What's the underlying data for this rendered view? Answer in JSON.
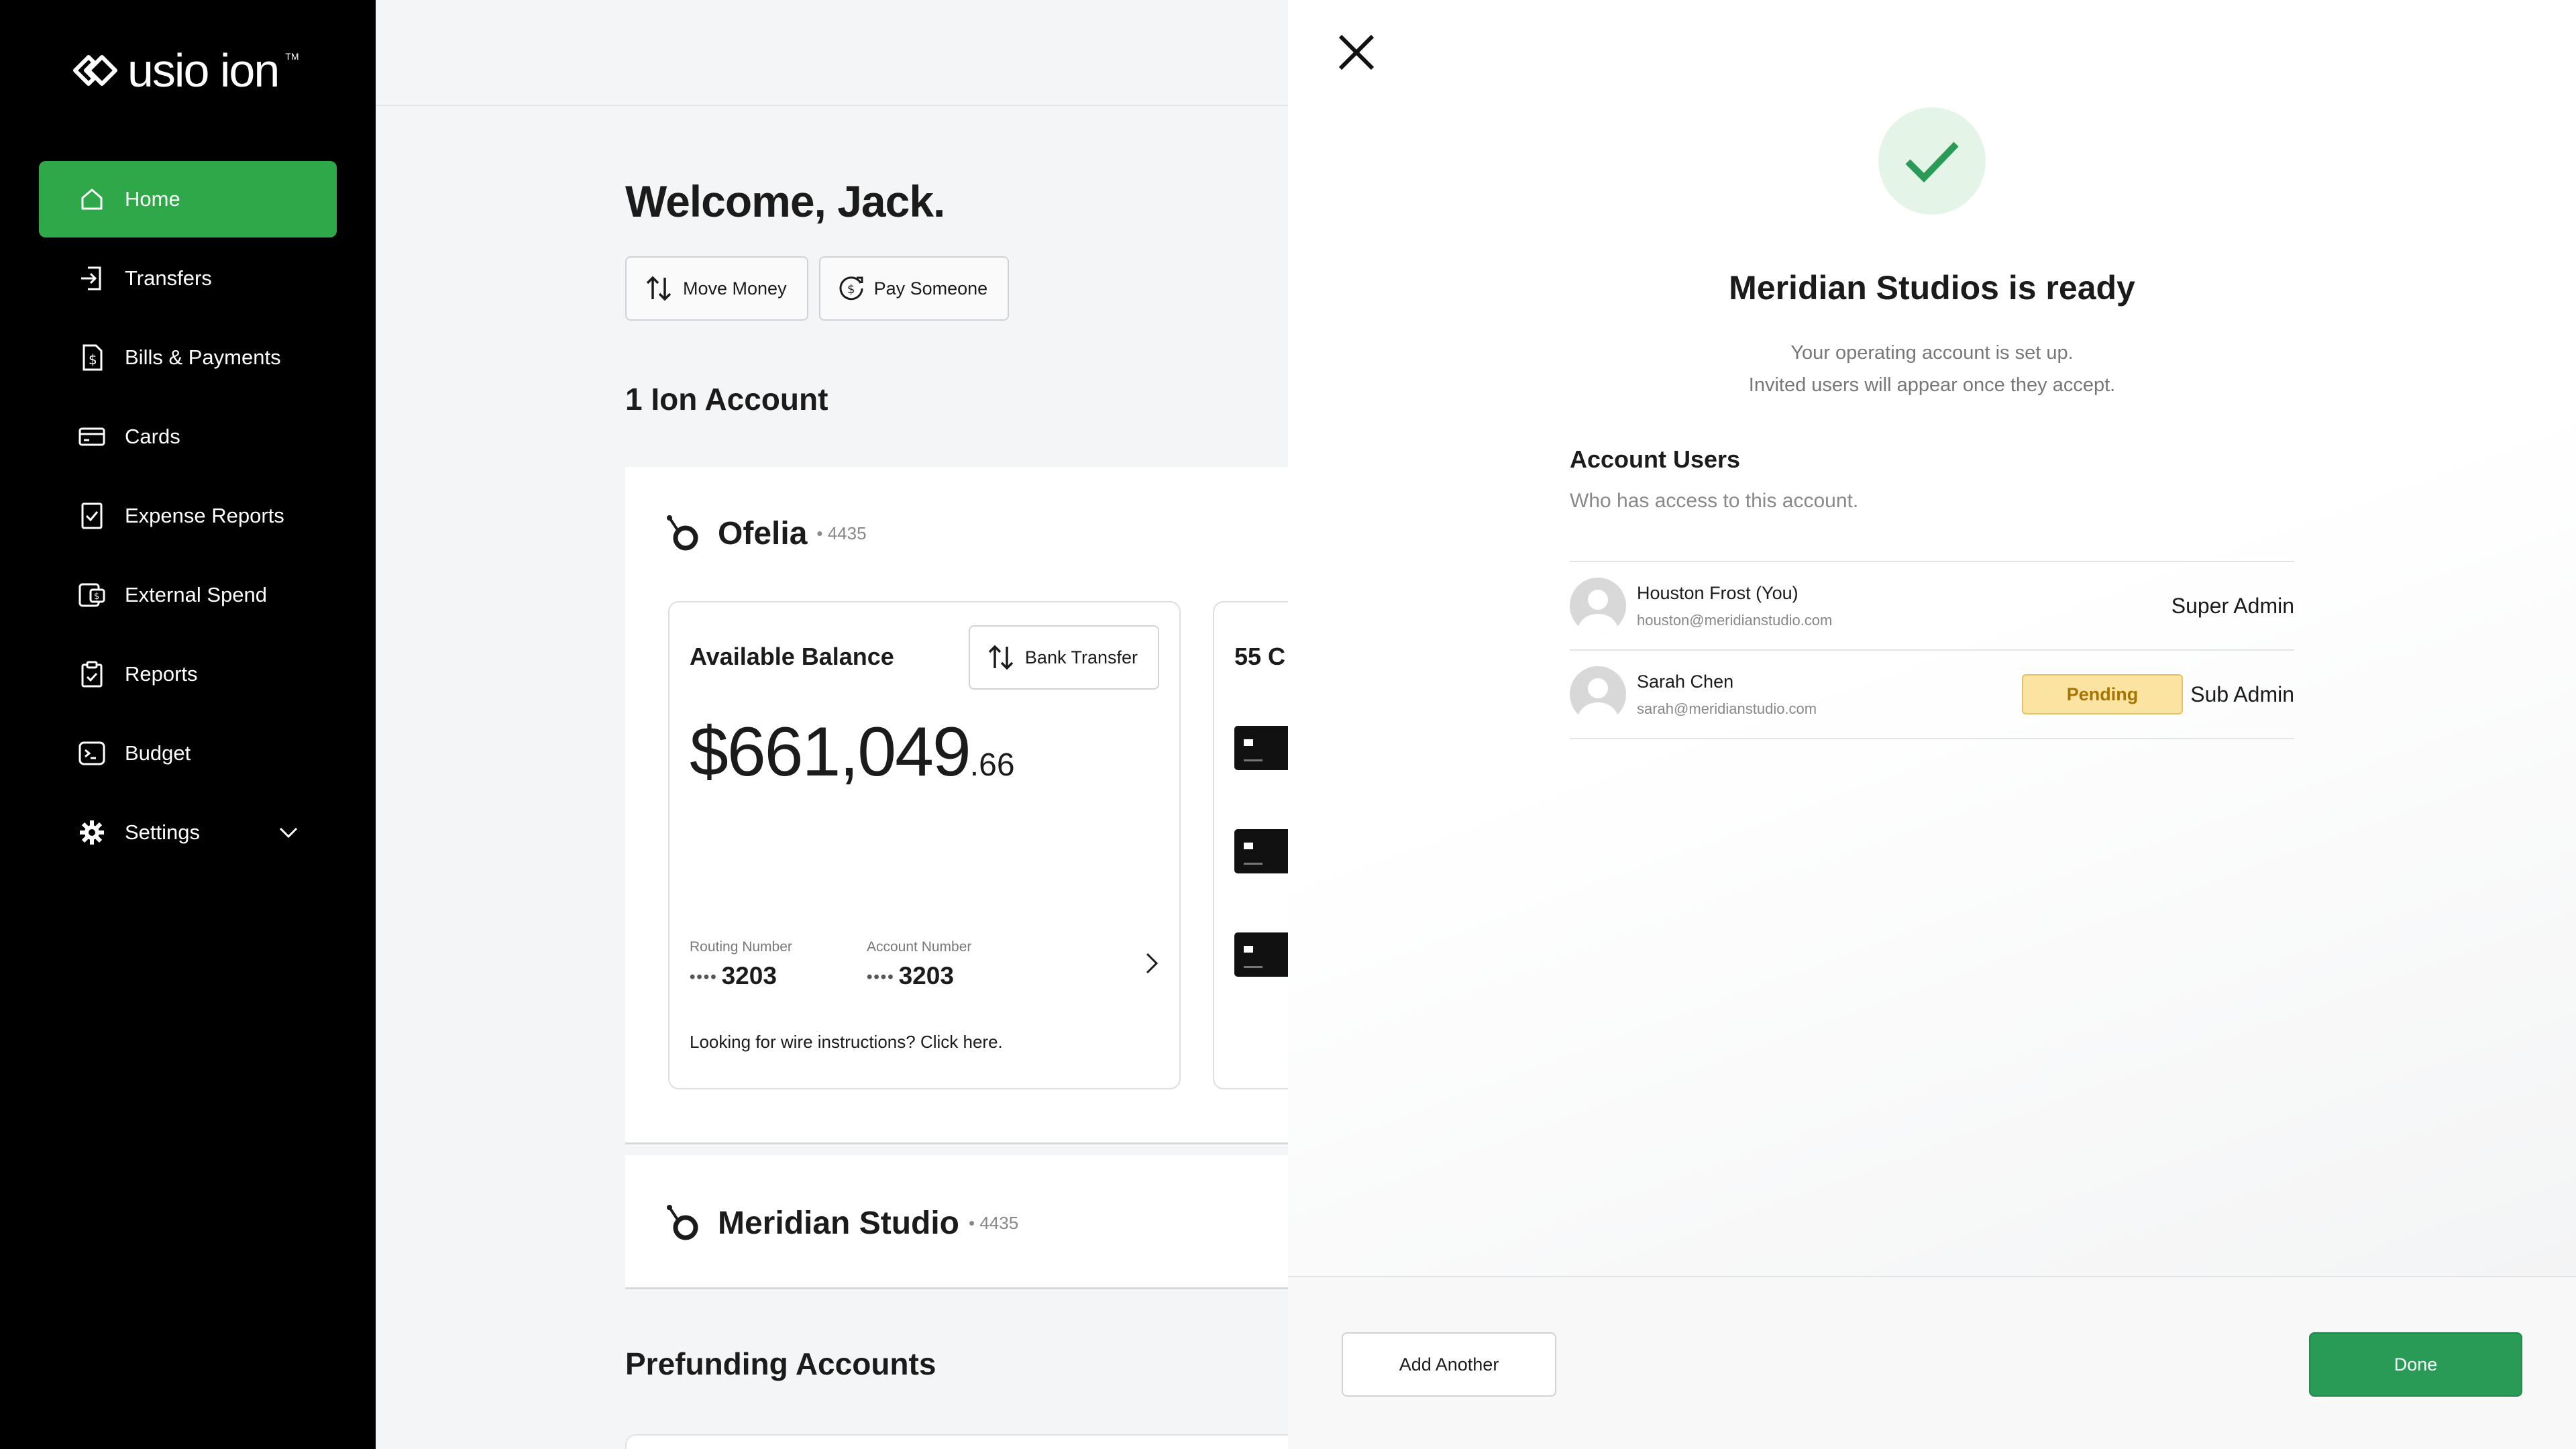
{
  "brand": {
    "logo_text": "usio ion",
    "logo_tm": "TM"
  },
  "sidebar": {
    "items": [
      {
        "label": "Home",
        "icon": "home-icon",
        "active": true
      },
      {
        "label": "Transfers",
        "icon": "transfer-icon"
      },
      {
        "label": "Bills & Payments",
        "icon": "bill-icon"
      },
      {
        "label": "Cards",
        "icon": "card-icon"
      },
      {
        "label": "Expense Reports",
        "icon": "expense-icon"
      },
      {
        "label": "External Spend",
        "icon": "external-spend-icon"
      },
      {
        "label": "Reports",
        "icon": "reports-icon"
      },
      {
        "label": "Budget",
        "icon": "budget-icon"
      },
      {
        "label": "Settings",
        "icon": "gear-icon",
        "expandable": true
      }
    ]
  },
  "main": {
    "welcome": "Welcome, Jack.",
    "actions": {
      "move_money": "Move Money",
      "pay_someone": "Pay Someone"
    },
    "ion_accounts_title": "1 Ion Account",
    "account1": {
      "name": "Ofelia",
      "number": "• 4435",
      "balance_label": "Available Balance",
      "bank_transfer": "Bank Transfer",
      "balance_main": "$661,049",
      "balance_cents": ".66",
      "routing_label": "Routing Number",
      "routing_dots": "••••",
      "routing_value": "3203",
      "account_label": "Account Number",
      "account_dots": "••••",
      "account_value": "3203",
      "wire_text": "Looking for wire instructions? Click here.",
      "cards_label": "55 C"
    },
    "account2": {
      "name": "Meridian Studio",
      "number": "• 4435"
    },
    "prefunding_title": "Prefunding Accounts"
  },
  "panel": {
    "title": "Meridian Studios is ready",
    "subtitle_line1": "Your operating account is set up.",
    "subtitle_line2": "Invited users will appear once they accept.",
    "users_title": "Account Users",
    "users_subtitle": "Who has access to this account.",
    "users": [
      {
        "name": "Houston Frost (You)",
        "email": "houston@meridianstudio.com",
        "role": "Super Admin",
        "status": ""
      },
      {
        "name": "Sarah Chen",
        "email": "sarah@meridianstudio.com",
        "role": "Sub Admin",
        "status": "Pending"
      }
    ],
    "add_another": "Add Another",
    "done": "Done"
  },
  "colors": {
    "accent_green": "#2fa84a",
    "done_green": "#2a9a57",
    "pending_bg": "#fbe3a1",
    "pending_text": "#a87400"
  }
}
